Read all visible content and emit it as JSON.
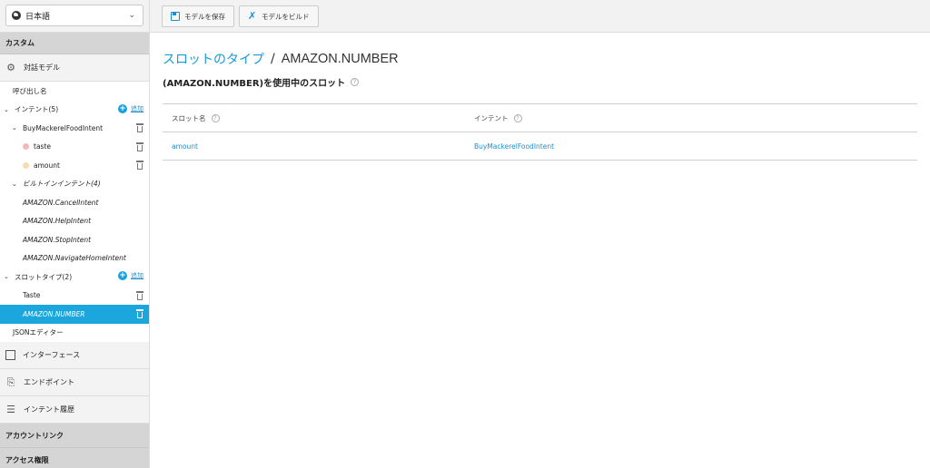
{
  "language": {
    "selected": "日本語"
  },
  "sidebar": {
    "custom_header": "カスタム",
    "dialog_model": "対話モデル",
    "invocation": "呼び出し名",
    "intents_label": "インテント(5)",
    "add_label": "追加",
    "custom_intent": "BuyMackerelFoodIntent",
    "slots": [
      {
        "label": "taste",
        "color": "#f4b8b8"
      },
      {
        "label": "amount",
        "color": "#f6dcae"
      }
    ],
    "builtin_label": "ビルトインインテント(4)",
    "builtin_intents": [
      "AMAZON.CancelIntent",
      "AMAZON.HelpIntent",
      "AMAZON.StopIntent",
      "AMAZON.NavigateHomeIntent"
    ],
    "slot_types_label": "スロットタイプ(2)",
    "slot_types": [
      "Taste",
      "AMAZON.NUMBER"
    ],
    "json_editor": "JSONエディター",
    "interfaces": "インターフェース",
    "endpoint": "エンドポイント",
    "intent_history": "インテント履歴",
    "account_linking": "アカウントリンク",
    "permissions": "アクセス権限"
  },
  "toolbar": {
    "save_label": "モデルを保存",
    "build_label": "モデルをビルド"
  },
  "main": {
    "breadcrumb_parent": "スロットのタイプ",
    "breadcrumb_sep": "/",
    "breadcrumb_current": "AMAZON.NUMBER",
    "usage_title": "(AMAZON.NUMBER)を使用中のスロット",
    "help_glyph": "?",
    "table": {
      "col_slot": "スロット名",
      "col_intent": "インテント",
      "rows": [
        {
          "slot": "amount",
          "intent": "BuyMackerelFoodIntent"
        }
      ]
    }
  },
  "colors": {
    "accent": "#1ba7de",
    "link": "#1a8fcf"
  }
}
